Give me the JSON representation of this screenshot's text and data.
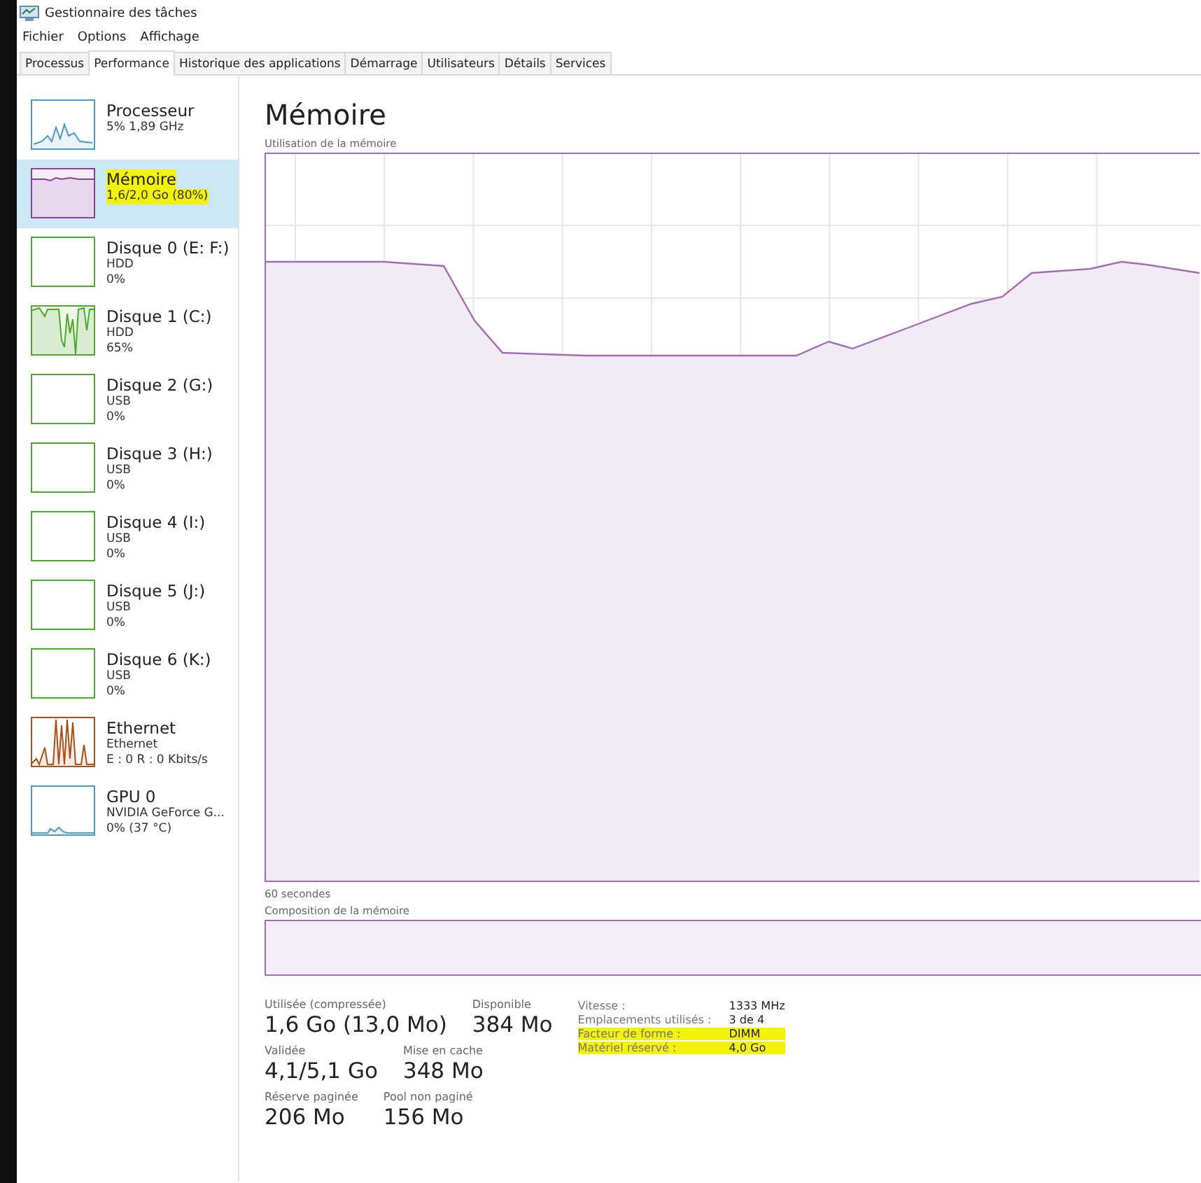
{
  "window": {
    "title": "Gestionnaire des tâches"
  },
  "menu": [
    "Fichier",
    "Options",
    "Affichage"
  ],
  "tabs": [
    {
      "label": "Processus",
      "selected": false
    },
    {
      "label": "Performance",
      "selected": true
    },
    {
      "label": "Historique des applications",
      "selected": false
    },
    {
      "label": "Démarrage",
      "selected": false
    },
    {
      "label": "Utilisateurs",
      "selected": false
    },
    {
      "label": "Détails",
      "selected": false
    },
    {
      "label": "Services",
      "selected": false
    }
  ],
  "sidebar": {
    "items": [
      {
        "kind": "cpu",
        "name": "Processeur",
        "lines": [
          "5% 1,89 GHz"
        ],
        "color": "#4a9ac4",
        "active": true,
        "selected": false,
        "highlighted": false
      },
      {
        "kind": "memory",
        "name": "Mémoire",
        "lines": [
          "1,6/2,0 Go (80%)"
        ],
        "color": "#8b3f9e",
        "active": true,
        "selected": true,
        "highlighted": true
      },
      {
        "kind": "disk",
        "name": "Disque 0 (E: F:)",
        "lines": [
          "HDD",
          "0%"
        ],
        "color": "#4da82c",
        "active": false,
        "selected": false,
        "highlighted": false
      },
      {
        "kind": "disk",
        "name": "Disque 1 (C:)",
        "lines": [
          "HDD",
          "65%"
        ],
        "color": "#4da82c",
        "active": true,
        "selected": false,
        "highlighted": false
      },
      {
        "kind": "disk",
        "name": "Disque 2 (G:)",
        "lines": [
          "USB",
          "0%"
        ],
        "color": "#4da82c",
        "active": false,
        "selected": false,
        "highlighted": false
      },
      {
        "kind": "disk",
        "name": "Disque 3 (H:)",
        "lines": [
          "USB",
          "0%"
        ],
        "color": "#4da82c",
        "active": false,
        "selected": false,
        "highlighted": false
      },
      {
        "kind": "disk",
        "name": "Disque 4 (I:)",
        "lines": [
          "USB",
          "0%"
        ],
        "color": "#4da82c",
        "active": false,
        "selected": false,
        "highlighted": false
      },
      {
        "kind": "disk",
        "name": "Disque 5 (J:)",
        "lines": [
          "USB",
          "0%"
        ],
        "color": "#4da82c",
        "active": false,
        "selected": false,
        "highlighted": false
      },
      {
        "kind": "disk",
        "name": "Disque 6 (K:)",
        "lines": [
          "USB",
          "0%"
        ],
        "color": "#4da82c",
        "active": false,
        "selected": false,
        "highlighted": false
      },
      {
        "kind": "ethernet",
        "name": "Ethernet",
        "lines": [
          "Ethernet",
          "E : 0 R : 0 Kbits/s"
        ],
        "color": "#a7511b",
        "active": true,
        "selected": false,
        "highlighted": false
      },
      {
        "kind": "gpu",
        "name": "GPU 0",
        "lines": [
          "NVIDIA GeForce G...",
          "0% (37 °C)"
        ],
        "color": "#4a9ac4",
        "active": true,
        "selected": false,
        "highlighted": false
      }
    ]
  },
  "main": {
    "title": "Mémoire",
    "chart_label": "Utilisation de la mémoire",
    "time_label": "60 secondes",
    "composition_label": "Composition de la mémoire",
    "stats": [
      [
        {
          "label": "Utilisée (compressée)",
          "value": "1,6 Go (13,0 Mo)"
        },
        {
          "label": "Disponible",
          "value": "384 Mo"
        }
      ],
      [
        {
          "label": "Validée",
          "value": "4,1/5,1 Go"
        },
        {
          "label": "Mise en cache",
          "value": "348 Mo"
        }
      ],
      [
        {
          "label": "Réserve paginée",
          "value": "206 Mo"
        },
        {
          "label": "Pool non paginé",
          "value": "156 Mo"
        }
      ]
    ],
    "details": [
      {
        "label": "Vitesse :",
        "value": "1333 MHz",
        "highlighted": false
      },
      {
        "label": "Emplacements utilisés :",
        "value": "3 de 4",
        "highlighted": false
      },
      {
        "label": "Facteur de forme :",
        "value": "DIMM",
        "highlighted": true
      },
      {
        "label": "Matériel réservé :",
        "value": "4,0 Go",
        "highlighted": true
      }
    ]
  }
}
